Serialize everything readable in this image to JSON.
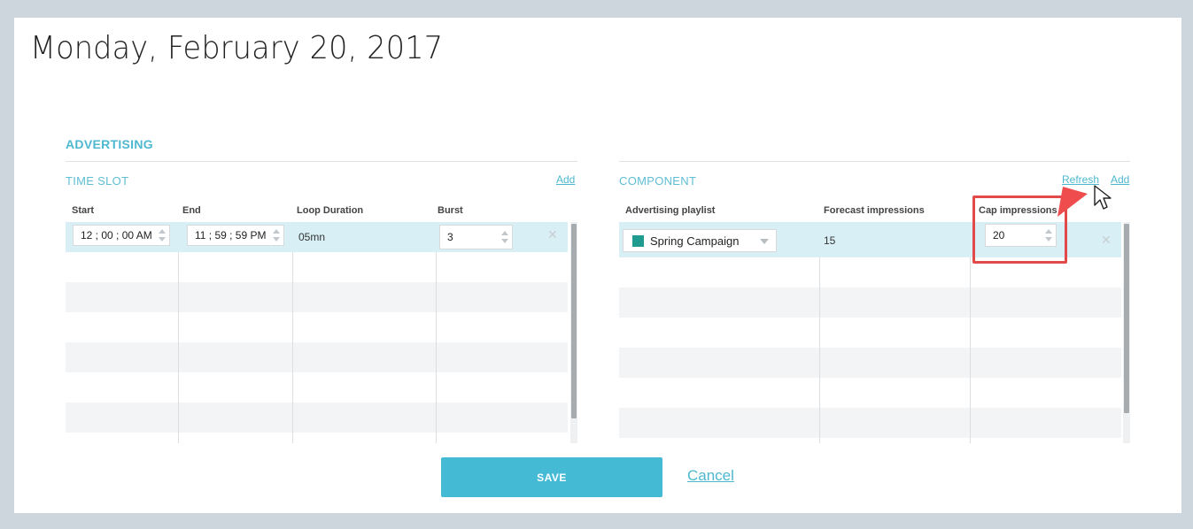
{
  "page": {
    "title": "Monday, February 20, 2017"
  },
  "advertising": {
    "section_title": "ADVERTISING"
  },
  "time_slot": {
    "title": "TIME SLOT",
    "add_label": "Add",
    "columns": [
      "Start",
      "End",
      "Loop Duration",
      "Burst"
    ],
    "rows": [
      {
        "start": "12 ; 00 ; 00 AM",
        "end": "11 ; 59 ; 59 PM",
        "loop_duration": "05mn",
        "burst": "3",
        "remove_icon": "close-icon"
      }
    ]
  },
  "component": {
    "title": "COMPONENT",
    "refresh_label": "Refresh",
    "add_label": "Add",
    "columns": [
      "Advertising playlist",
      "Forecast impressions",
      "Cap impressions"
    ],
    "rows": [
      {
        "playlist": "Spring Campaign",
        "playlist_color": "#1f9b8f",
        "forecast": "15",
        "cap": "20",
        "remove_icon": "close-icon"
      }
    ]
  },
  "actions": {
    "save_label": "SAVE",
    "cancel_label": "Cancel"
  },
  "colors": {
    "accent": "#45bad5",
    "highlight": "#e24a4a",
    "selected_row": "#d8eff5"
  }
}
